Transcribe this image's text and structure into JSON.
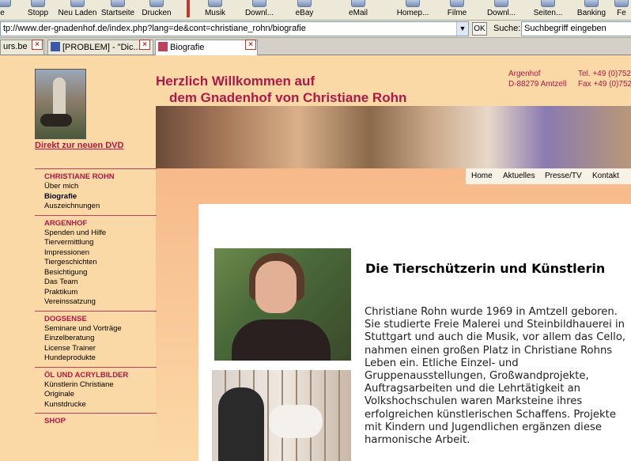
{
  "toolbar": {
    "buttons": [
      {
        "label": "e"
      },
      {
        "label": "Stopp"
      },
      {
        "label": "Neu Laden"
      },
      {
        "label": "Startseite"
      },
      {
        "label": "Drucken"
      },
      {
        "label": "Musik"
      },
      {
        "label": "Downl..."
      },
      {
        "label": "eBay"
      },
      {
        "label": "eMail"
      },
      {
        "label": "Homep..."
      },
      {
        "label": "Filme"
      },
      {
        "label": "Downl..."
      },
      {
        "label": "Seiten..."
      },
      {
        "label": "Banking"
      },
      {
        "label": "Fe"
      }
    ]
  },
  "address": {
    "url": "tp://www.der-gnadenhof.de/index.php?lang=de&cont=christiane_rohn/biografie",
    "ok": "OK",
    "search_label": "Suche:",
    "search_placeholder": "Suchbegriff eingeben"
  },
  "tabs": [
    {
      "label": "urs.be"
    },
    {
      "label": "[PROBLEM] - \"Dic..."
    },
    {
      "label": "Biografie"
    }
  ],
  "header": {
    "title_line1": "Herzlich Willkommen auf",
    "title_line2": "dem Gnadenhof von Christiane Rohn",
    "addr_line1": "Argenhof",
    "addr_line2": "D-88279 Amtzell",
    "tel_line1": "Tel. +49 (0)752",
    "tel_line2": "Fax +49 (0)752"
  },
  "dvd_link": "Direkt zur neuen DVD",
  "topnav": [
    "Home",
    "Aktuelles",
    "Presse/TV",
    "Kontakt"
  ],
  "nav": [
    {
      "heading": "CHRISTIANE ROHN",
      "items": [
        {
          "label": "Über mich"
        },
        {
          "label": "Biografie",
          "current": true
        },
        {
          "label": "Auszeichnungen"
        }
      ]
    },
    {
      "heading": "ARGENHOF",
      "items": [
        {
          "label": "Spenden und Hilfe"
        },
        {
          "label": "Tiervermittlung"
        },
        {
          "label": "Impressionen"
        },
        {
          "label": "Tiergeschichten"
        },
        {
          "label": "Besichtigung"
        },
        {
          "label": "Das Team"
        },
        {
          "label": "Praktikum"
        },
        {
          "label": "Vereinssatzung"
        }
      ]
    },
    {
      "heading": "DOGSENSE",
      "items": [
        {
          "label": "Seminare und Vorträge"
        },
        {
          "label": "Einzelberatung"
        },
        {
          "label": "License Trainer"
        },
        {
          "label": "Hundeprodukte"
        }
      ]
    },
    {
      "heading": "ÖL UND ACRYLBILDER",
      "items": [
        {
          "label": "Künstlerin Christiane"
        },
        {
          "label": "Originale"
        },
        {
          "label": "Kunstdrucke"
        }
      ]
    },
    {
      "heading": "SHOP",
      "items": []
    }
  ],
  "content": {
    "title": "Die Tierschützerin und Künstlerin",
    "text": "Christiane Rohn wurde 1969 in Amtzell geboren. Sie studierte Freie Malerei und Steinbildhauerei in Stuttgart und auch die Musik, vor allem das Cello, nahmen einen großen Platz in Christiane Rohns Leben ein. Etliche Einzel- und Gruppenausstellungen, Großwandprojekte, Auftragsarbeiten und die Lehrtätigkeit an Volkshochschulen waren Marksteine ihres erfolgreichen künstlerischen Schaffens. Projekte mit Kindern und Jugendlichen ergänzen diese harmonische Arbeit."
  }
}
